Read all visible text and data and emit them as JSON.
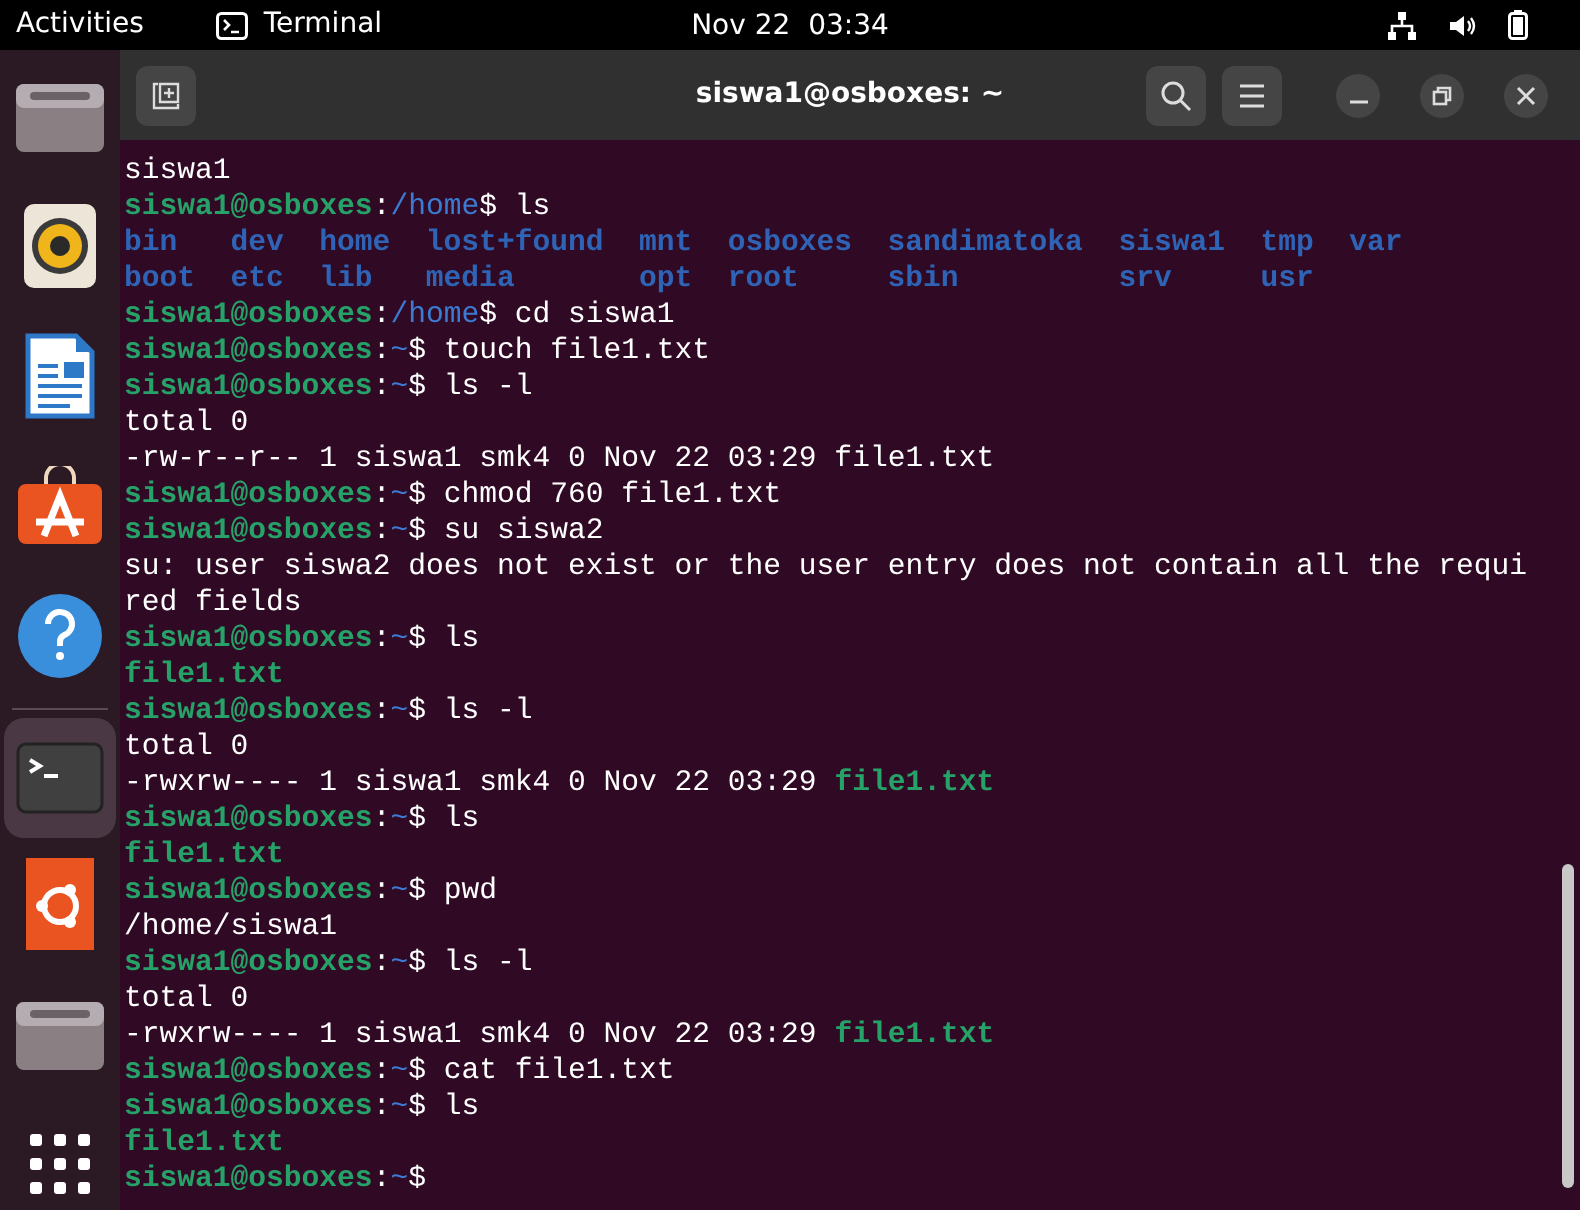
{
  "top_bar": {
    "activities": "Activities",
    "app": {
      "label": "Terminal"
    },
    "clock": "Nov 22  03:34"
  },
  "dock": [
    {
      "kind": "drive",
      "selected": false
    },
    {
      "kind": "speaker",
      "selected": false
    },
    {
      "kind": "document",
      "selected": false
    },
    {
      "kind": "store",
      "selected": false
    },
    {
      "kind": "help",
      "selected": false
    },
    {
      "kind": "separator"
    },
    {
      "kind": "terminal",
      "selected": true
    },
    {
      "kind": "ubuntu",
      "selected": false
    },
    {
      "kind": "drive",
      "selected": false
    },
    {
      "kind": "grid",
      "selected": false
    }
  ],
  "window": {
    "title": "siswa1@osboxes: ~"
  },
  "terminal": {
    "lines": [
      {
        "kind": "text",
        "segments": [
          {
            "kind": "plain",
            "text": "siswa1"
          }
        ]
      },
      {
        "kind": "text",
        "segments": [
          {
            "kind": "user",
            "text": "siswa1@osboxes"
          },
          {
            "kind": "plain",
            "text": ":"
          },
          {
            "kind": "path",
            "text": "/home"
          },
          {
            "kind": "plain",
            "text": "$ ls"
          }
        ]
      },
      {
        "kind": "columns",
        "rows": [
          [
            "bin",
            "dev",
            "home",
            "lost+found",
            "mnt",
            "osboxes",
            "sandimatoka",
            "siswa1",
            "tmp",
            "var"
          ],
          [
            "boot",
            "etc",
            "lib",
            "media",
            "opt",
            "root",
            "sbin",
            "srv",
            "usr"
          ]
        ]
      },
      {
        "kind": "text",
        "segments": [
          {
            "kind": "user",
            "text": "siswa1@osboxes"
          },
          {
            "kind": "plain",
            "text": ":"
          },
          {
            "kind": "path",
            "text": "/home"
          },
          {
            "kind": "plain",
            "text": "$ cd siswa1"
          }
        ]
      },
      {
        "kind": "text",
        "segments": [
          {
            "kind": "user",
            "text": "siswa1@osboxes"
          },
          {
            "kind": "plain",
            "text": ":"
          },
          {
            "kind": "path",
            "text": "~"
          },
          {
            "kind": "plain",
            "text": "$ touch file1.txt"
          }
        ]
      },
      {
        "kind": "text",
        "segments": [
          {
            "kind": "user",
            "text": "siswa1@osboxes"
          },
          {
            "kind": "plain",
            "text": ":"
          },
          {
            "kind": "path",
            "text": "~"
          },
          {
            "kind": "plain",
            "text": "$ ls -l"
          }
        ]
      },
      {
        "kind": "text",
        "segments": [
          {
            "kind": "plain",
            "text": "total 0"
          }
        ]
      },
      {
        "kind": "text",
        "segments": [
          {
            "kind": "plain",
            "text": "-rw-r--r-- 1 siswa1 smk4 0 Nov 22 03:29 file1.txt"
          }
        ]
      },
      {
        "kind": "text",
        "segments": [
          {
            "kind": "user",
            "text": "siswa1@osboxes"
          },
          {
            "kind": "plain",
            "text": ":"
          },
          {
            "kind": "path",
            "text": "~"
          },
          {
            "kind": "plain",
            "text": "$ chmod 760 file1.txt"
          }
        ]
      },
      {
        "kind": "text",
        "segments": [
          {
            "kind": "user",
            "text": "siswa1@osboxes"
          },
          {
            "kind": "plain",
            "text": ":"
          },
          {
            "kind": "path",
            "text": "~"
          },
          {
            "kind": "plain",
            "text": "$ su siswa2"
          }
        ]
      },
      {
        "kind": "text",
        "segments": [
          {
            "kind": "plain",
            "text": "su: user siswa2 does not exist or the user entry does not contain all the requi"
          }
        ]
      },
      {
        "kind": "text",
        "segments": [
          {
            "kind": "plain",
            "text": "red fields"
          }
        ]
      },
      {
        "kind": "text",
        "segments": [
          {
            "kind": "user",
            "text": "siswa1@osboxes"
          },
          {
            "kind": "plain",
            "text": ":"
          },
          {
            "kind": "path",
            "text": "~"
          },
          {
            "kind": "plain",
            "text": "$ ls"
          }
        ]
      },
      {
        "kind": "text",
        "segments": [
          {
            "kind": "file",
            "text": "file1.txt"
          }
        ]
      },
      {
        "kind": "text",
        "segments": [
          {
            "kind": "user",
            "text": "siswa1@osboxes"
          },
          {
            "kind": "plain",
            "text": ":"
          },
          {
            "kind": "path",
            "text": "~"
          },
          {
            "kind": "plain",
            "text": "$ ls -l"
          }
        ]
      },
      {
        "kind": "text",
        "segments": [
          {
            "kind": "plain",
            "text": "total 0"
          }
        ]
      },
      {
        "kind": "text",
        "segments": [
          {
            "kind": "plain",
            "text": "-rwxrw---- 1 siswa1 smk4 0 Nov 22 03:29 "
          },
          {
            "kind": "file",
            "text": "file1.txt"
          }
        ]
      },
      {
        "kind": "text",
        "segments": [
          {
            "kind": "user",
            "text": "siswa1@osboxes"
          },
          {
            "kind": "plain",
            "text": ":"
          },
          {
            "kind": "path",
            "text": "~"
          },
          {
            "kind": "plain",
            "text": "$ ls"
          }
        ]
      },
      {
        "kind": "text",
        "segments": [
          {
            "kind": "file",
            "text": "file1.txt"
          }
        ]
      },
      {
        "kind": "text",
        "segments": [
          {
            "kind": "user",
            "text": "siswa1@osboxes"
          },
          {
            "kind": "plain",
            "text": ":"
          },
          {
            "kind": "path",
            "text": "~"
          },
          {
            "kind": "plain",
            "text": "$ pwd"
          }
        ]
      },
      {
        "kind": "text",
        "segments": [
          {
            "kind": "plain",
            "text": "/home/siswa1"
          }
        ]
      },
      {
        "kind": "text",
        "segments": [
          {
            "kind": "user",
            "text": "siswa1@osboxes"
          },
          {
            "kind": "plain",
            "text": ":"
          },
          {
            "kind": "path",
            "text": "~"
          },
          {
            "kind": "plain",
            "text": "$ ls -l"
          }
        ]
      },
      {
        "kind": "text",
        "segments": [
          {
            "kind": "plain",
            "text": "total 0"
          }
        ]
      },
      {
        "kind": "text",
        "segments": [
          {
            "kind": "plain",
            "text": "-rwxrw---- 1 siswa1 smk4 0 Nov 22 03:29 "
          },
          {
            "kind": "file",
            "text": "file1.txt"
          }
        ]
      },
      {
        "kind": "text",
        "segments": [
          {
            "kind": "user",
            "text": "siswa1@osboxes"
          },
          {
            "kind": "plain",
            "text": ":"
          },
          {
            "kind": "path",
            "text": "~"
          },
          {
            "kind": "plain",
            "text": "$ cat file1.txt"
          }
        ]
      },
      {
        "kind": "text",
        "segments": [
          {
            "kind": "user",
            "text": "siswa1@osboxes"
          },
          {
            "kind": "plain",
            "text": ":"
          },
          {
            "kind": "path",
            "text": "~"
          },
          {
            "kind": "plain",
            "text": "$ ls"
          }
        ]
      },
      {
        "kind": "text",
        "segments": [
          {
            "kind": "file",
            "text": "file1.txt"
          }
        ]
      },
      {
        "kind": "text",
        "segments": [
          {
            "kind": "user",
            "text": "siswa1@osboxes"
          },
          {
            "kind": "plain",
            "text": ":"
          },
          {
            "kind": "path",
            "text": "~"
          },
          {
            "kind": "plain",
            "text": "$"
          }
        ]
      }
    ]
  }
}
